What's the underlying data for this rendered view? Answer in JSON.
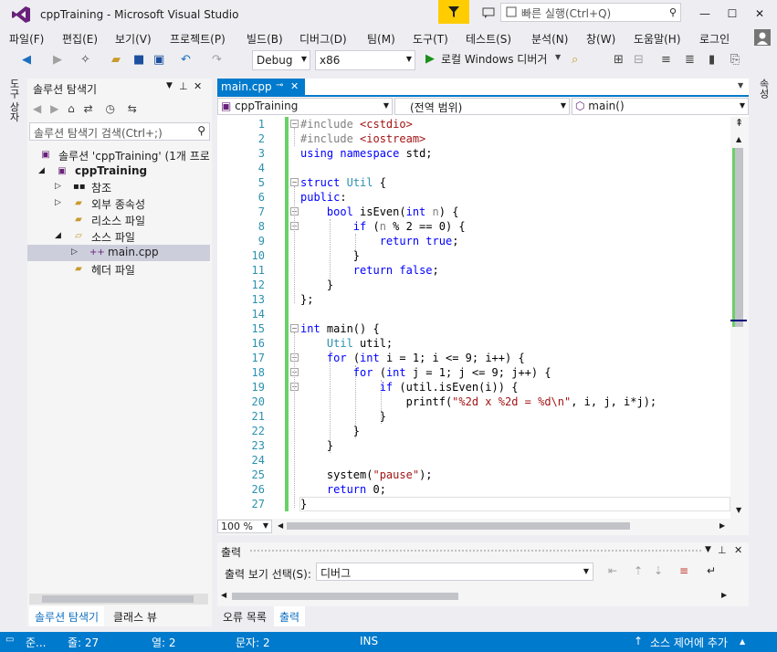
{
  "window": {
    "title": "cppTraining - Microsoft Visual Studio",
    "quick_launch_placeholder": "빠른 실행(Ctrl+Q)"
  },
  "menu": [
    "파일(F)",
    "편집(E)",
    "보기(V)",
    "프로젝트(P)",
    "빌드(B)",
    "디버그(D)",
    "팀(M)",
    "도구(T)",
    "테스트(S)",
    "분석(N)",
    "창(W)",
    "도움말(H)",
    "로그인"
  ],
  "toolbar": {
    "config": "Debug",
    "platform": "x86",
    "run_label": "로컬 Windows 디버거"
  },
  "side_tabs": {
    "left": "도구 상자",
    "right": "속성"
  },
  "solution_explorer": {
    "title": "솔루션 탐색기",
    "search_placeholder": "솔루션 탐색기 검색(Ctrl+;)",
    "items": [
      {
        "label": "솔루션 'cppTraining' (1개 프로",
        "icon": "solution-icon"
      },
      {
        "label": "cppTraining",
        "icon": "project-icon",
        "bold": true
      },
      {
        "label": "참조",
        "icon": "references-icon"
      },
      {
        "label": "외부 종속성",
        "icon": "folder-icon"
      },
      {
        "label": "리소스 파일",
        "icon": "folder-icon"
      },
      {
        "label": "소스 파일",
        "icon": "folder-icon"
      },
      {
        "label": "main.cpp",
        "icon": "cpp-file-icon",
        "selected": true
      },
      {
        "label": "헤더 파일",
        "icon": "folder-icon"
      }
    ],
    "bottom_tabs": [
      "솔루션 탐색기",
      "클래스 뷰"
    ]
  },
  "editor": {
    "tab": "main.cpp",
    "nav": {
      "project": "cppTraining",
      "scope": "(전역 범위)",
      "member": "main()"
    },
    "zoom": "100 %",
    "lines": [
      "#include <cstdio>",
      "#include <iostream>",
      "using namespace std;",
      "",
      "struct Util {",
      "public:",
      "    bool isEven(int n) {",
      "        if (n % 2 == 0) {",
      "            return true;",
      "        }",
      "        return false;",
      "    }",
      "};",
      "",
      "int main() {",
      "    Util util;",
      "    for (int i = 1; i <= 9; i++) {",
      "        for (int j = 1; j <= 9; j++) {",
      "            if (util.isEven(i)) {",
      "                printf(\"%2d x %2d = %d\\n\", i, j, i*j);",
      "            }",
      "        }",
      "    }",
      "",
      "    system(\"pause\");",
      "    return 0;",
      "}"
    ]
  },
  "output": {
    "title": "출력",
    "source_label": "출력 보기 선택(S):",
    "source_value": "디버그",
    "bottom_tabs": [
      "오류 목록",
      "출력"
    ]
  },
  "status": {
    "ready": "준...",
    "line": "줄: 27",
    "col": "열: 2",
    "char": "문자: 2",
    "ins": "INS",
    "source_control": "소스 제어에 추가"
  }
}
